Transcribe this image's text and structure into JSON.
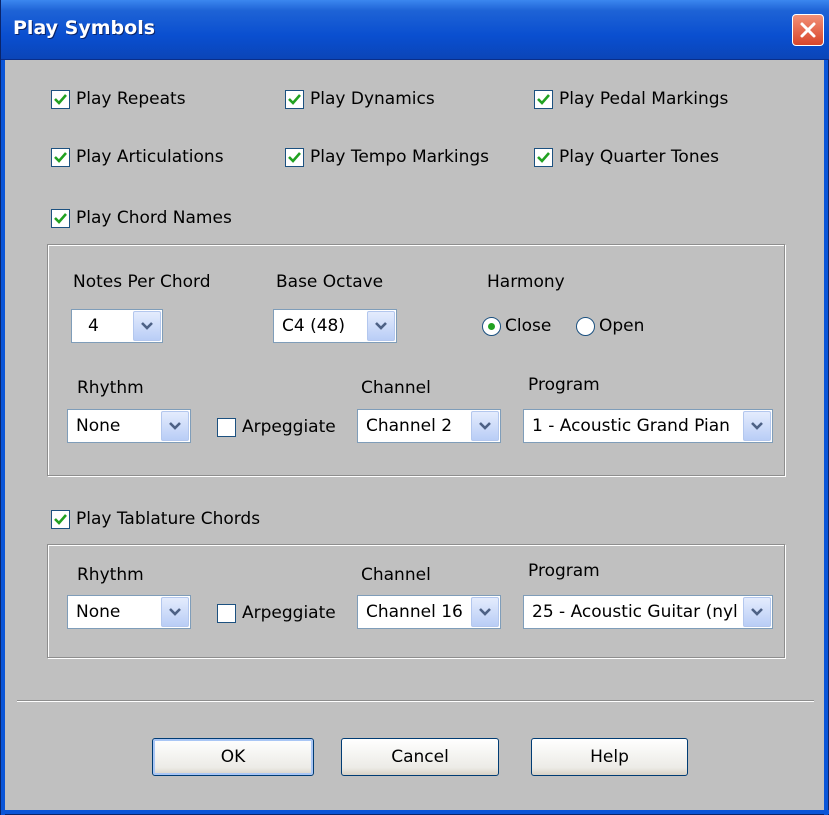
{
  "window": {
    "title": "Play Symbols"
  },
  "checkboxes": {
    "play_repeats": {
      "label": "Play Repeats",
      "checked": true
    },
    "play_dynamics": {
      "label": "Play Dynamics",
      "checked": true
    },
    "play_pedal_markings": {
      "label": "Play Pedal Markings",
      "checked": true
    },
    "play_articulations": {
      "label": "Play Articulations",
      "checked": true
    },
    "play_tempo_markings": {
      "label": "Play Tempo Markings",
      "checked": true
    },
    "play_quarter_tones": {
      "label": "Play Quarter Tones",
      "checked": true
    },
    "play_chord_names": {
      "label": "Play Chord Names",
      "checked": true
    },
    "play_tablature_chords": {
      "label": "Play Tablature Chords",
      "checked": true
    }
  },
  "chord_names": {
    "notes_per_chord": {
      "label": "Notes Per Chord",
      "value": "4"
    },
    "base_octave": {
      "label": "Base Octave",
      "value": "C4 (48)"
    },
    "harmony": {
      "label": "Harmony",
      "options": [
        "Close",
        "Open"
      ],
      "selected": "Close"
    },
    "rhythm": {
      "label": "Rhythm",
      "value": "None"
    },
    "arpeggiate": {
      "label": "Arpeggiate",
      "checked": false
    },
    "channel": {
      "label": "Channel",
      "value": "Channel 2"
    },
    "program": {
      "label": "Program",
      "value": "1 - Acoustic Grand Pian"
    }
  },
  "tablature_chords": {
    "rhythm": {
      "label": "Rhythm",
      "value": "None"
    },
    "arpeggiate": {
      "label": "Arpeggiate",
      "checked": false
    },
    "channel": {
      "label": "Channel",
      "value": "Channel 16"
    },
    "program": {
      "label": "Program",
      "value": "25 - Acoustic Guitar (nyl"
    }
  },
  "buttons": {
    "ok": "OK",
    "cancel": "Cancel",
    "help": "Help"
  },
  "colors": {
    "title_bar": "#0a4fd0",
    "check_mark": "#21a121",
    "close_button": "#d8452a"
  }
}
